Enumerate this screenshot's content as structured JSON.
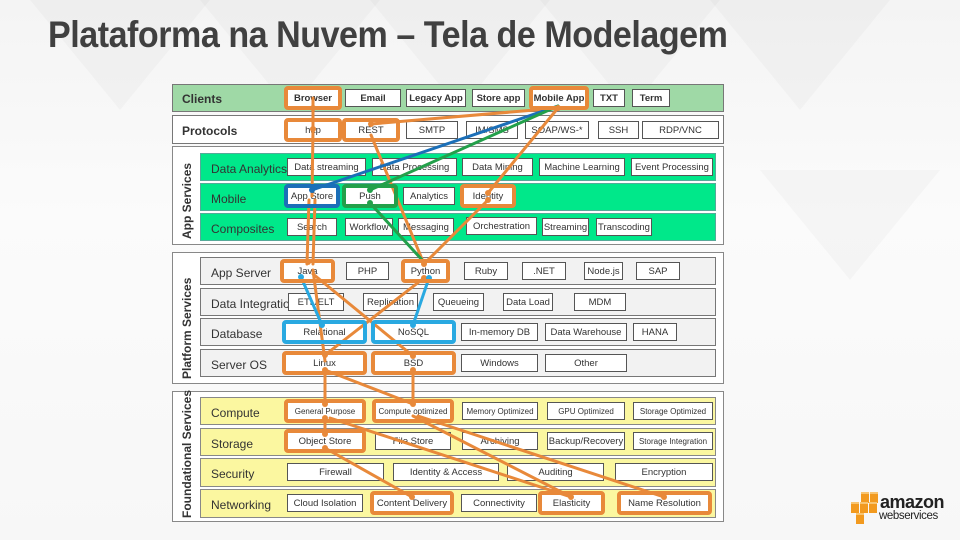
{
  "title": "Plataforma na Nuvem – Tela de Modelagem",
  "colors": {
    "clients_bg": "#9fd9a6",
    "app_services_row": "#00e88a",
    "platform_row": "#f2f2f2",
    "foundational_row": "#fbf7a0",
    "highlight_orange": "#e8893a",
    "highlight_blue": "#1b6fb8",
    "highlight_green": "#23a04a",
    "highlight_cyan": "#29a9e1",
    "aws_orange": "#f29a1f"
  },
  "clients": {
    "label": "Clients",
    "items": [
      "Browser",
      "Email",
      "Legacy App",
      "Store app",
      "Mobile App",
      "TXT",
      "Term"
    ]
  },
  "protocols": {
    "label": "Protocols",
    "items": [
      "http",
      "REST",
      "SMTP",
      "IM/SMS",
      "SOAP/WS-*",
      "SSH",
      "RDP/VNC"
    ]
  },
  "app_services": {
    "label": "App Services",
    "rows": [
      {
        "label": "Data Analytics",
        "items": [
          "Data streaming",
          "Data Processing",
          "Data Mining",
          "Machine Learning",
          "Event Processing"
        ]
      },
      {
        "label": "Mobile",
        "items": [
          "App Store",
          "Push",
          "Analytics",
          "Identity"
        ]
      },
      {
        "label": "Composites",
        "items": [
          "Search",
          "Workflow",
          "Messaging",
          "Orchestration",
          "Streaming",
          "Transcoding"
        ]
      }
    ]
  },
  "platform_services": {
    "label": "Platform Services",
    "rows": [
      {
        "label": "App Server",
        "items": [
          "Java",
          "PHP",
          "Python",
          "Ruby",
          ".NET",
          "Node.js",
          "SAP"
        ]
      },
      {
        "label": "Data Integration",
        "items": [
          "ETL/ELT",
          "Replication",
          "Queueing",
          "Data Load",
          "MDM"
        ]
      },
      {
        "label": "Database",
        "items": [
          "Relational",
          "NoSQL",
          "In-memory DB",
          "Data Warehouse",
          "HANA"
        ]
      },
      {
        "label": "Server OS",
        "items": [
          "Linux",
          "BSD",
          "Windows",
          "Other"
        ]
      }
    ]
  },
  "foundational_services": {
    "label": "Foundational Services",
    "rows": [
      {
        "label": "Compute",
        "items": [
          "General Purpose",
          "Compute optimized",
          "Memory Optimized",
          "GPU Optimized",
          "Storage Optimized"
        ]
      },
      {
        "label": "Storage",
        "items": [
          "Object Store",
          "File Store",
          "Archiving",
          "Backup/Recovery",
          "Storage Integration"
        ]
      },
      {
        "label": "Security",
        "items": [
          "Firewall",
          "Identity & Access",
          "Auditing",
          "Encryption"
        ]
      },
      {
        "label": "Networking",
        "items": [
          "Cloud Isolation",
          "Content Delivery",
          "Connectivity",
          "Elasticity",
          "Name Resolution"
        ]
      }
    ]
  },
  "logo": {
    "icon": "aws-cubes-icon",
    "line1": "amazon",
    "line2": "webservices"
  }
}
